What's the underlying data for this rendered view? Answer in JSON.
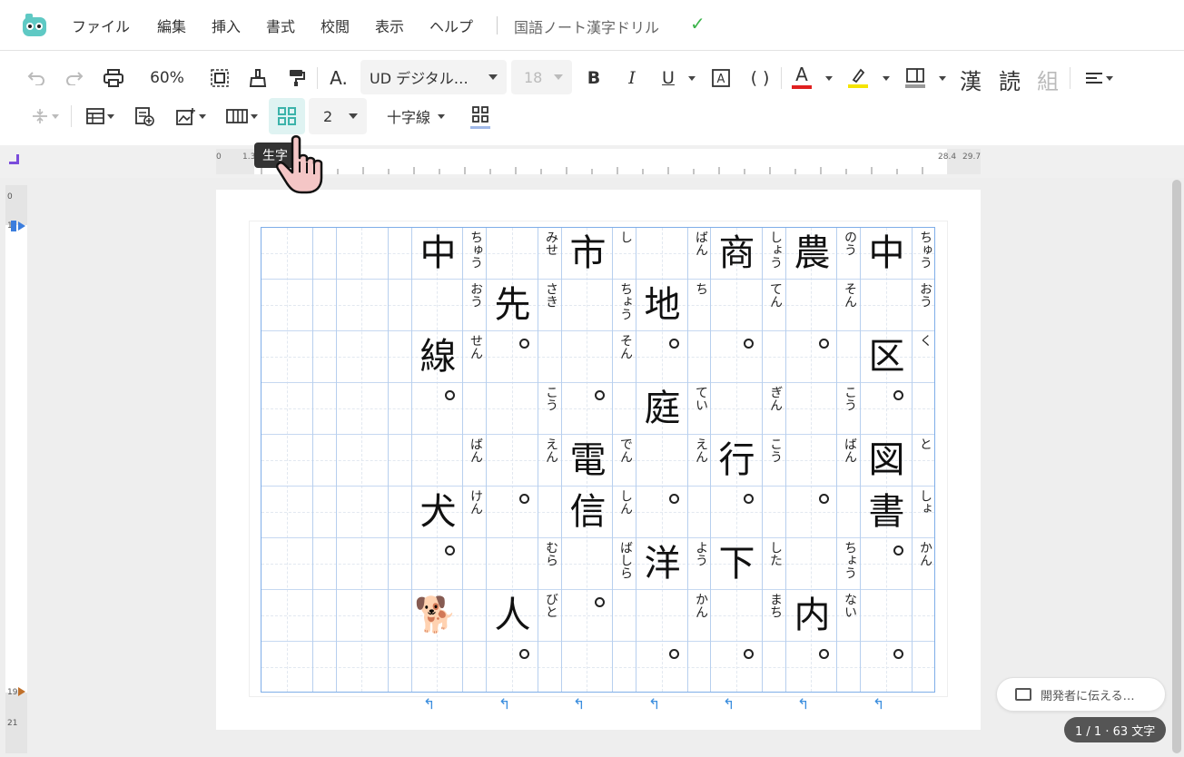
{
  "menubar": {
    "logo": "app-logo",
    "items": [
      "ファイル",
      "編集",
      "挿入",
      "書式",
      "校閲",
      "表示",
      "ヘルプ"
    ],
    "doc_title": "国語ノート漢字ドリル",
    "saved_icon": "check-icon",
    "saved_color": "#3cb44b"
  },
  "toolbar": {
    "zoom": "60%",
    "font_name": "UD デジタル…",
    "font_size": "18",
    "grid_count": "2",
    "line_style": "十字線",
    "kanji_buttons": [
      "漢",
      "読",
      "組"
    ],
    "font_color": "#e02020",
    "highlight_color": "#f5e400",
    "tooltip": "生字"
  },
  "ruler": {
    "marks": [
      "0",
      "1.3",
      "28.4",
      "29.7"
    ],
    "vmarks": [
      "0",
      "1",
      "19",
      "21"
    ]
  },
  "drill": {
    "columns": [
      {
        "kanji": [
          "中",
          "",
          "区",
          "",
          "図",
          "書",
          "",
          "",
          ""
        ],
        "furigana": [
          "ちゅう",
          "おう",
          "く",
          "",
          "と",
          "しょ",
          "かん",
          "",
          ""
        ],
        "maru": [
          3,
          6,
          8
        ]
      },
      {
        "kanji": [
          "農",
          "",
          "",
          "",
          "",
          "",
          "",
          "内",
          ""
        ],
        "furigana": [
          "のう",
          "そん",
          "",
          "こう",
          "ばん",
          "",
          "ちょう",
          "ない",
          ""
        ],
        "maru": [
          2,
          5,
          8
        ]
      },
      {
        "kanji": [
          "商",
          "",
          "",
          "",
          "行",
          "",
          "下",
          "",
          ""
        ],
        "furigana": [
          "しょう",
          "てん",
          "",
          "ぎん",
          "こう",
          "",
          "した",
          "まち",
          ""
        ],
        "maru": [
          2,
          5,
          8
        ]
      },
      {
        "kanji": [
          "",
          "地",
          "",
          "庭",
          "",
          "",
          "洋",
          "",
          ""
        ],
        "furigana": [
          "ばん",
          "ち",
          "",
          "てい",
          "えん",
          "",
          "よう",
          "かん",
          ""
        ],
        "maru": [
          2,
          5,
          8
        ]
      },
      {
        "kanji": [
          "市",
          "",
          "",
          "",
          "電",
          "信",
          "",
          "",
          ""
        ],
        "furigana": [
          "し",
          "ちょう",
          "そん",
          "",
          "でん",
          "しん",
          "ばしら",
          "",
          ""
        ],
        "maru": [
          3,
          7
        ]
      },
      {
        "kanji": [
          "",
          "先",
          "",
          "",
          "",
          "",
          "",
          "人",
          ""
        ],
        "furigana": [
          "みせ",
          "さき",
          "",
          "こう",
          "えん",
          "",
          "むら",
          "びと",
          ""
        ],
        "maru": [
          2,
          5,
          8
        ]
      },
      {
        "kanji": [
          "中",
          "",
          "線",
          "",
          "",
          "犬",
          "",
          "",
          ""
        ],
        "furigana": [
          "ちゅう",
          "おう",
          "せん",
          "",
          "ばん",
          "けん",
          "",
          "",
          ""
        ],
        "maru": [
          3,
          6
        ]
      }
    ],
    "dog_icon": "dog-emoji",
    "dog": "🐕"
  },
  "feedback_label": "開発者に伝える…",
  "counter": "1 / 1 · 63 文字"
}
